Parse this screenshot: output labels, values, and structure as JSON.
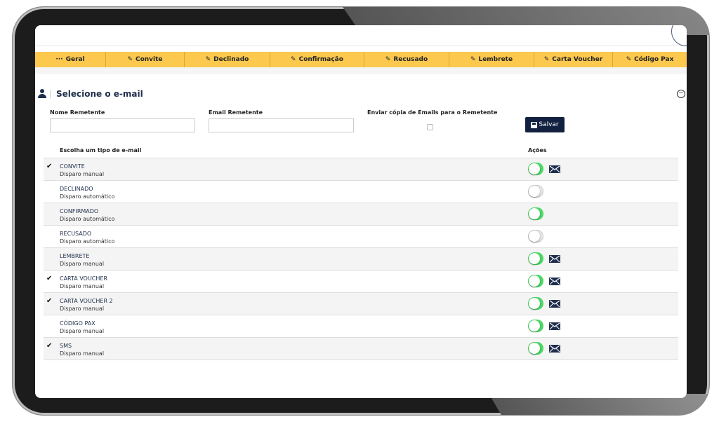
{
  "tabs": [
    {
      "label": "Geral",
      "icon": "dots-icon"
    },
    {
      "label": "Convite",
      "icon": "pencil-icon"
    },
    {
      "label": "Declinado",
      "icon": "pencil-icon"
    },
    {
      "label": "Confirmação",
      "icon": "pencil-icon"
    },
    {
      "label": "Recusado",
      "icon": "pencil-icon"
    },
    {
      "label": "Lembrete",
      "icon": "pencil-icon"
    },
    {
      "label": "Carta Voucher",
      "icon": "pencil-icon"
    },
    {
      "label": "Código Pax",
      "icon": "pencil-icon"
    }
  ],
  "section": {
    "title": "Selecione o e-mail"
  },
  "form": {
    "sender_name_label": "Nome Remetente",
    "sender_name_value": "",
    "sender_email_label": "Email Remetente",
    "sender_email_value": "",
    "copy_label": "Enviar cópia de Emails para o Remetente",
    "copy_checked": false,
    "save_label": "Salvar"
  },
  "table": {
    "col_type": "Escolha um tipo de e-mail",
    "col_actions": "Ações",
    "rows": [
      {
        "name": "CONVITE",
        "mode": "Disparo manual",
        "checked": true,
        "enabled": true,
        "mail": true
      },
      {
        "name": "DECLINADO",
        "mode": "Disparo automático",
        "checked": false,
        "enabled": false,
        "mail": false
      },
      {
        "name": "CONFIRMADO",
        "mode": "Disparo automático",
        "checked": false,
        "enabled": true,
        "mail": false
      },
      {
        "name": "RECUSADO",
        "mode": "Disparo automático",
        "checked": false,
        "enabled": false,
        "mail": false
      },
      {
        "name": "LEMBRETE",
        "mode": "Disparo manual",
        "checked": false,
        "enabled": true,
        "mail": true
      },
      {
        "name": "CARTA VOUCHER",
        "mode": "Disparo manual",
        "checked": true,
        "enabled": true,
        "mail": true
      },
      {
        "name": "CARTA VOUCHER 2",
        "mode": "Disparo manual",
        "checked": true,
        "enabled": true,
        "mail": true
      },
      {
        "name": "CÓDIGO PAX",
        "mode": "Disparo manual",
        "checked": false,
        "enabled": true,
        "mail": true
      },
      {
        "name": "SMS",
        "mode": "Disparo manual",
        "checked": true,
        "enabled": true,
        "mail": true
      }
    ]
  },
  "colors": {
    "tab_bar": "#fcc94e",
    "navy": "#1f2e4c",
    "toggle_on": "#4cd964",
    "save_button": "#12213f"
  }
}
